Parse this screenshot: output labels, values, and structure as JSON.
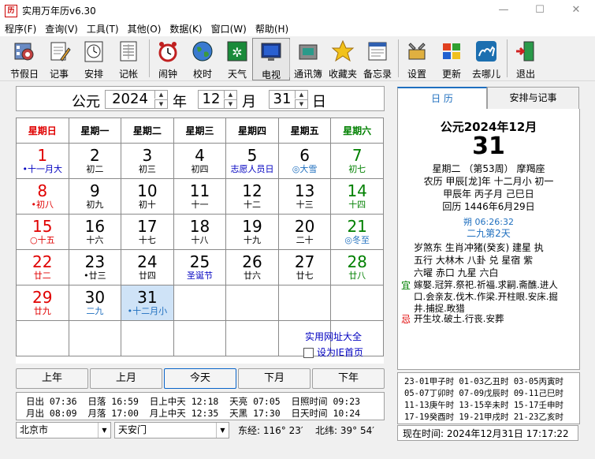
{
  "window": {
    "title": "实用万年历v6.30",
    "icon_char": "历"
  },
  "menu": [
    "程序(F)",
    "查询(V)",
    "工具(T)",
    "其他(O)",
    "数据(K)",
    "窗口(W)",
    "帮助(H)"
  ],
  "toolbar": [
    {
      "label": "节假日",
      "icon": "film-icon"
    },
    {
      "label": "记事",
      "icon": "notepad-pen-icon"
    },
    {
      "label": "安排",
      "icon": "clock-schedule-icon"
    },
    {
      "label": "记帐",
      "icon": "ledger-icon"
    },
    {
      "label": "闹钟",
      "icon": "alarm-clock-icon"
    },
    {
      "label": "校时",
      "icon": "globe-icon"
    },
    {
      "label": "天气",
      "icon": "weather-icon"
    },
    {
      "label": "电视",
      "icon": "tv-icon"
    },
    {
      "label": "通讯簿",
      "icon": "phone-book-icon"
    },
    {
      "label": "收藏夹",
      "icon": "star-icon"
    },
    {
      "label": "备忘录",
      "icon": "memo-icon"
    },
    {
      "label": "设置",
      "icon": "tools-icon"
    },
    {
      "label": "更新",
      "icon": "windows-icon"
    },
    {
      "label": "去哪儿",
      "icon": "camel-icon"
    },
    {
      "label": "退出",
      "icon": "exit-door-icon"
    }
  ],
  "date_selector": {
    "era": "公元",
    "year": "2024",
    "year_label": "年",
    "month": "12",
    "month_label": "月",
    "day": "31",
    "day_label": "日"
  },
  "weekdays": [
    "星期日",
    "星期一",
    "星期二",
    "星期三",
    "星期四",
    "星期五",
    "星期六"
  ],
  "calendar_rows": [
    [
      {
        "d": "1",
        "l": "•十一月大",
        "dc": "red",
        "lc": "blue"
      },
      {
        "d": "2",
        "l": "初二"
      },
      {
        "d": "3",
        "l": "初三"
      },
      {
        "d": "4",
        "l": "初四"
      },
      {
        "d": "5",
        "l": "志愿人员日",
        "lc": "blue"
      },
      {
        "d": "6",
        "l": "◎大雪",
        "lc": "teal"
      },
      {
        "d": "7",
        "l": "初七",
        "dc": "green",
        "lc": "green"
      }
    ],
    [
      {
        "d": "8",
        "l": "•初八",
        "dc": "red",
        "lc": "red"
      },
      {
        "d": "9",
        "l": "初九"
      },
      {
        "d": "10",
        "l": "初十"
      },
      {
        "d": "11",
        "l": "十一"
      },
      {
        "d": "12",
        "l": "十二"
      },
      {
        "d": "13",
        "l": "十三"
      },
      {
        "d": "14",
        "l": "十四",
        "dc": "green",
        "lc": "green"
      }
    ],
    [
      {
        "d": "15",
        "l": "○十五",
        "dc": "red",
        "lc": "red"
      },
      {
        "d": "16",
        "l": "十六"
      },
      {
        "d": "17",
        "l": "十七"
      },
      {
        "d": "18",
        "l": "十八"
      },
      {
        "d": "19",
        "l": "十九"
      },
      {
        "d": "20",
        "l": "二十"
      },
      {
        "d": "21",
        "l": "◎冬至",
        "dc": "green",
        "lc": "teal"
      }
    ],
    [
      {
        "d": "22",
        "l": "廿二",
        "dc": "red",
        "lc": "red"
      },
      {
        "d": "23",
        "l": "•廿三"
      },
      {
        "d": "24",
        "l": "廿四"
      },
      {
        "d": "25",
        "l": "圣诞节",
        "lc": "blue"
      },
      {
        "d": "26",
        "l": "廿六"
      },
      {
        "d": "27",
        "l": "廿七"
      },
      {
        "d": "28",
        "l": "廿八",
        "dc": "green",
        "lc": "green"
      }
    ],
    [
      {
        "d": "29",
        "l": "廿九",
        "dc": "red",
        "lc": "red"
      },
      {
        "d": "30",
        "l": "二九",
        "lc": "teal"
      },
      {
        "d": "31",
        "l": "•十二月小",
        "lc": "teal",
        "today": true
      },
      {
        "d": "",
        "l": ""
      },
      {
        "d": "",
        "l": ""
      },
      {
        "d": "",
        "l": ""
      },
      {
        "d": "",
        "l": ""
      }
    ],
    [
      {
        "d": "",
        "l": ""
      },
      {
        "d": "",
        "l": ""
      },
      {
        "d": "",
        "l": ""
      },
      {
        "d": "",
        "l": ""
      },
      {
        "d": "",
        "l": ""
      },
      {
        "d": "",
        "l": ""
      },
      {
        "d": "",
        "l": ""
      }
    ]
  ],
  "links": {
    "sites": "实用网址大全",
    "homepage": "设为IE首页"
  },
  "nav_buttons": [
    "上年",
    "上月",
    "今天",
    "下月",
    "下年"
  ],
  "sun_info": {
    "row1": "日出 07:36  日落 16:59  日上中天 12:18  天亮 07:05  日照时间 09:23",
    "row2": "月出 08:09  月落 17:00  月上中天 12:35  天黑 17:30  日天时间 10:24"
  },
  "location": {
    "city": "北京市",
    "place": "天安门",
    "longitude": "东经: 116° 23′",
    "latitude": "北纬: 39° 54′"
  },
  "tabs": [
    "日    历",
    "安排与记事"
  ],
  "detail": {
    "header": "公元2024年12月",
    "day": "31",
    "line1": "星期二 （第53周） 摩羯座",
    "line2": "农历 甲辰[龙]年 十二月小 初一",
    "line3": "甲辰年 丙子月 己巳日",
    "line4": "回历 1446年6月29日",
    "shuo": "朔 06:26:32",
    "jiu": "二九第2天",
    "sha1": "岁煞东 生肖冲猪(癸亥)  建星 执",
    "sha2": "五行 大林木  八卦 兑  星宿 紫",
    "sha3": "六曜 赤口  九星 六白",
    "yi_label": "宜",
    "yi1": "嫁娶.冠笄.祭祀.祈福.求嗣.斋醮.进人",
    "yi2": "口.会亲友.伐木.作梁.开柱眼.安床.掘",
    "yi3": "井.捕捉.畋猎",
    "ji_label": "忌",
    "ji1": "开生坟.破土.行丧.安葬"
  },
  "ganzhi_hours": [
    "23-01甲子时 01-03乙丑时 03-05丙寅时",
    "05-07丁卯时 07-09戊辰时 09-11己巳时",
    "11-13庚午时 13-15辛未时 15-17壬申时",
    "17-19癸酉时 19-21甲戌时 21-23乙亥时"
  ],
  "now": "现在时间: 2024年12月31日  17:17:22",
  "colors": {
    "sunday": "#e00000",
    "saturday": "#008000",
    "festival": "#0000c0",
    "solarterm": "#1f6fbf",
    "today_bg": "#cfe3f7"
  }
}
